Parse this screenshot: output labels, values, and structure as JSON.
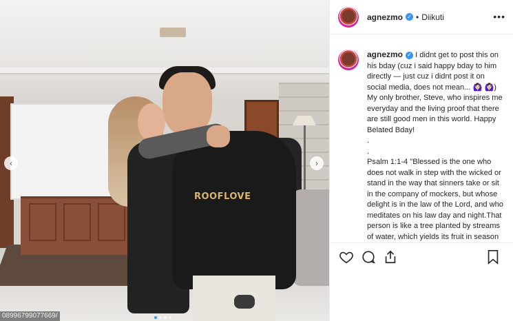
{
  "post": {
    "carousel": {
      "prev_glyph": "‹",
      "next_glyph": "›",
      "dot_count": 4,
      "active_dot": 0,
      "watermark": "08996799077669/"
    },
    "photo": {
      "shirt_text": "ROOFLOVE"
    }
  },
  "header": {
    "username": "agnezmo",
    "verified_icon": "verified-badge-icon",
    "separator": "•",
    "follow_status": "Diikuti",
    "more_icon": "more-options-icon",
    "more_glyph": "•••"
  },
  "caption": {
    "username": "agnezmo",
    "text": " I didnt get to post this on his bday (cuz i said happy bday to him directly — just cuz i didnt post it on social media, does not mean... 🙆🏻‍♀️ 🙆🏻‍♀️) My only brother, Steve, who inspires me everyday and the living proof that there are still good men in this world. Happy Belated Bday!\n.\n.\nPsalm 1:1-4 \"Blessed is the one who does not walk in step with the wicked or stand in the way that sinners take or sit in the company of mockers, but whose delight is in the law of the Lord, and who meditates on his law day and night.That person is like a tree planted by streams of water, which yields its fruit in season and whose leaf does"
  },
  "actions": {
    "like_icon": "heart-icon",
    "comment_icon": "comment-icon",
    "share_icon": "share-icon",
    "save_icon": "bookmark-icon"
  },
  "colors": {
    "accent": "#3897f0",
    "text": "#262626",
    "border": "#efefef"
  }
}
